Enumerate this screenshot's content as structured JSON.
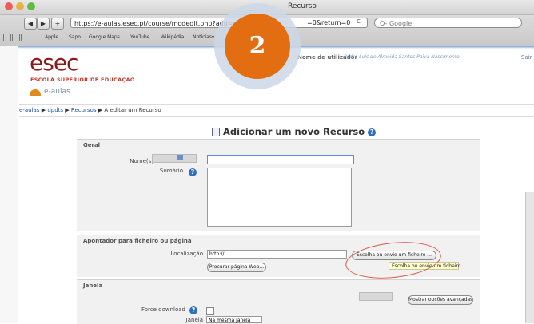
{
  "browser": {
    "window_title": "Recurso",
    "url": "https://e-aulas.esec.pt/course/modedit.php?add=resour",
    "url_tail": "=0&return=0",
    "search_placeholder": "Q- Google",
    "back": "◀",
    "forward": "▶",
    "new_tab": "+",
    "reload": "c",
    "bookmarks": [
      "Apple",
      "Sapo",
      "Google Maps",
      "YouTube",
      "Wikipédia",
      "Notícias▾"
    ]
  },
  "header": {
    "logo": "esec",
    "logo_subtitle": "ESCOLA SUPERIOR DE EDUCAÇÃO",
    "site_name": "e-aulas",
    "user_label": "Nome de utilizador",
    "user_name": "Pedro Luís de Almeida Santos Paiva Nascimento",
    "logout": "Sair"
  },
  "breadcrumb": {
    "items": [
      "e-aulas",
      "dpdts",
      "Recursos"
    ],
    "separator": "▶",
    "current": "A editar um Recurso"
  },
  "page": {
    "heading": "Adicionar um novo Recurso",
    "step_badge": "2"
  },
  "form": {
    "geral": {
      "title": "Geral",
      "name_label": "Nome(s)",
      "name_value": "",
      "summary_label": "Sumário",
      "summary_value": "",
      "help_icon": "?"
    },
    "apontador": {
      "title": "Apontador para ficheiro ou página",
      "location_label": "Localização",
      "location_value": "http://",
      "choose_button": "Escolha ou envie um ficheiro ...",
      "search_web_button": "Procurar página Web...",
      "tooltip": "Escolha ou envie um ficheiro"
    },
    "janela": {
      "title": "Janela",
      "advanced_button": "Mostrar opções avançadas",
      "force_download_label": "Force download",
      "window_label": "Janela",
      "window_value": "Na mesma janela"
    }
  },
  "colors": {
    "logo": "#8b1a1a",
    "link": "#1d4fa6",
    "badge": "#e36e12",
    "highlight": "#d85a4a",
    "help": "#2f6fc1"
  }
}
